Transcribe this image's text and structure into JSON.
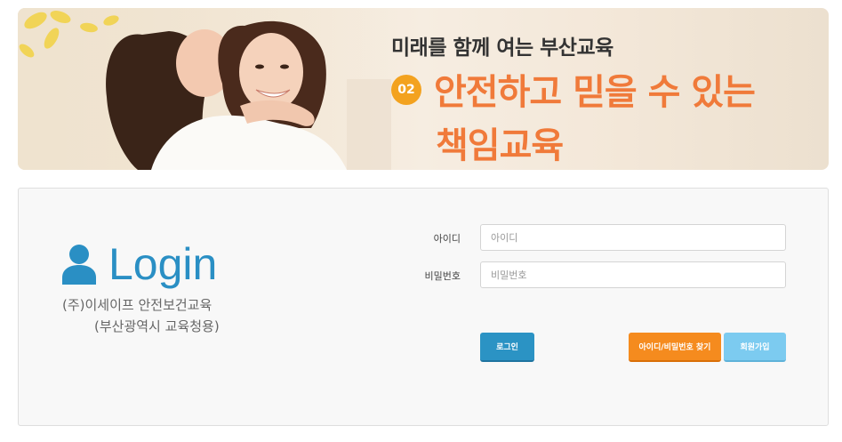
{
  "banner": {
    "subtitle": "미래를 함께 여는 부산교육",
    "badge": "02",
    "headline_line1": "안전하고 믿을 수 있는",
    "headline_line2": "책임교육"
  },
  "login": {
    "title": "Login",
    "org_line1": "(주)이세이프 안전보건교육",
    "org_line2": "(부산광역시 교육청용)",
    "id_label": "아이디",
    "id_placeholder": "아이디",
    "pw_label": "비밀번호",
    "pw_placeholder": "비밀번호",
    "login_button": "로그인",
    "find_button": "아이디/비밀번호 찾기",
    "join_button": "회원가입"
  },
  "icons": {
    "user": "user-icon"
  },
  "colors": {
    "accent_blue": "#2a8fc4",
    "accent_orange": "#f07a3a",
    "find_orange": "#f58b1e",
    "join_light_blue": "#7ccbf0"
  }
}
